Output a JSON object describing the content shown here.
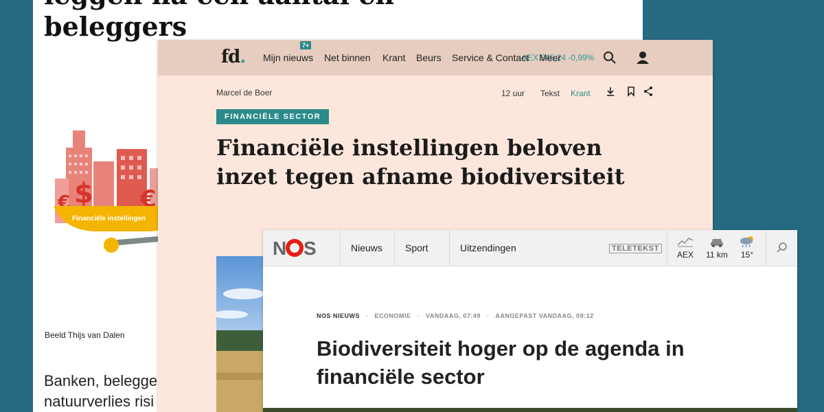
{
  "back_page": {
    "headline_line1": "leggen na een aantal en",
    "headline_line2": "beleggers",
    "illustration_label": "Financiële instellingen",
    "caption": "Beeld Thijs van Dalen",
    "lead_line1": "Banken, belegge",
    "lead_line2": "natuurverlies risi"
  },
  "fd": {
    "logo_text": "fd",
    "logo_dot": ".",
    "nav": [
      "Mijn nieuws",
      "Net binnen",
      "Krant",
      "Beurs",
      "Service & Contact",
      "Meer"
    ],
    "badge": "7+",
    "aex": "AEX 545,24  -0,99%",
    "author": "Marcel de Boer",
    "time": "12 uur",
    "view_text": "Tekst",
    "view_krant": "Krant",
    "tag": "FINANCIËLE SECTOR",
    "title": "Financiële instellingen beloven inzet tegen afname biodiversiteit",
    "colors": {
      "accent": "#2b8a8a",
      "nav_bg": "#e6cdbf",
      "page_bg": "#fde7dc"
    }
  },
  "nos": {
    "logo": "NOS",
    "nav": [
      "Nieuws",
      "Sport",
      "Uitzendingen"
    ],
    "teletekst": "TELETEKST",
    "widgets": {
      "aex": "AEX",
      "traffic": "11 km",
      "weather": "15°"
    },
    "meta": {
      "source": "NOS NIEUWS",
      "category": "ECONOMIE",
      "published": "VANDAAG, 07:49",
      "updated": "AANGEPAST VANDAAG, 09:12"
    },
    "title": "Biodiversiteit hoger op de agenda in financiële sector",
    "colors": {
      "logo_red": "#e61e14",
      "logo_grey": "#666666"
    }
  }
}
